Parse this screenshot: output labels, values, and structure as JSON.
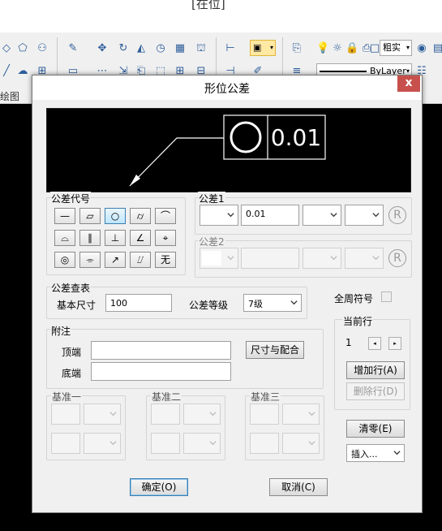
{
  "app": {
    "window_title_fragment": "[在位]",
    "ribbon_label": "绘图",
    "linetype_select": "粗实",
    "layer_select": "ByLayer"
  },
  "dialog": {
    "title": "形位公差",
    "close_label": "x",
    "preview": {
      "symbol": "circle",
      "value": "0.01"
    },
    "symbols_group": {
      "label": "公差代号",
      "symbols": [
        {
          "name": "straightness",
          "glyph": "—"
        },
        {
          "name": "flatness",
          "glyph": "▱"
        },
        {
          "name": "roundness",
          "glyph": "○"
        },
        {
          "name": "cylindricity",
          "glyph": "⌭"
        },
        {
          "name": "profile-of-line",
          "glyph": "⌒"
        },
        {
          "name": "profile-of-surface",
          "glyph": "⌓"
        },
        {
          "name": "parallelism",
          "glyph": "∥"
        },
        {
          "name": "perpendicularity",
          "glyph": "⊥"
        },
        {
          "name": "angularity",
          "glyph": "∠"
        },
        {
          "name": "position",
          "glyph": "⌖"
        },
        {
          "name": "concentricity",
          "glyph": "◎"
        },
        {
          "name": "symmetry",
          "glyph": "⌯"
        },
        {
          "name": "circular-runout",
          "glyph": "↗"
        },
        {
          "name": "total-runout",
          "glyph": "⌰"
        },
        {
          "name": "none",
          "glyph": "无"
        }
      ],
      "selected_index": 2
    },
    "tolerance1": {
      "label": "公差1",
      "value": "0.01",
      "r_label": "R"
    },
    "tolerance2": {
      "label": "公差2",
      "r_label": "R"
    },
    "lookup": {
      "label": "公差查表",
      "basic_size_label": "基本尺寸",
      "basic_size_value": "100",
      "grade_label": "公差等级",
      "grade_value": "7级"
    },
    "around_symbol_label": "全周符号",
    "current_row": {
      "label": "当前行",
      "value": "1",
      "prev": "◂",
      "next": "▸",
      "add_button": "增加行(A)",
      "delete_button": "删除行(D)"
    },
    "notes": {
      "label": "附注",
      "top_label": "顶端",
      "bottom_label": "底端",
      "fit_button": "尺寸与配合"
    },
    "datums": [
      {
        "label": "基准一"
      },
      {
        "label": "基准二"
      },
      {
        "label": "基准三"
      }
    ],
    "clear_button": "清零(E)",
    "insert_select": "插入...",
    "ok_button": "确定(O)",
    "cancel_button": "取消(C)"
  }
}
